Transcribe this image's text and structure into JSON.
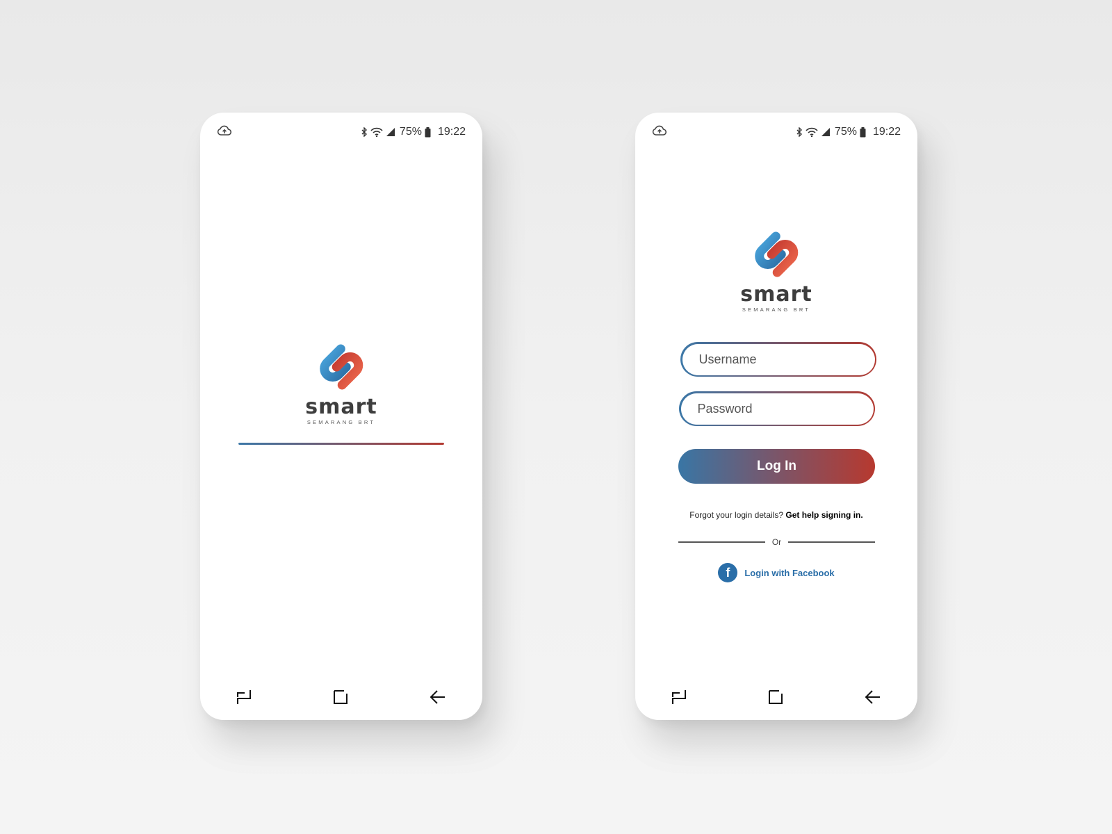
{
  "status_bar": {
    "battery_percent": "75%",
    "time": "19:22"
  },
  "brand": {
    "name": "smart",
    "subtitle": "SEMARANG BRT",
    "colors": {
      "blue": "#3c78a8",
      "red": "#b33a31",
      "text": "#3e3e3e"
    }
  },
  "splash": {
    "progress": 1.0
  },
  "login": {
    "username_placeholder": "Username",
    "password_placeholder": "Password",
    "login_button": "Log In",
    "forgot_text": "Forgot your login details?",
    "help_link": "Get help signing in.",
    "divider_text": "Or",
    "facebook_text": "Login with Facebook",
    "facebook_icon_letter": "f"
  },
  "nav_icons": [
    "recents-icon",
    "home-icon",
    "back-icon"
  ]
}
